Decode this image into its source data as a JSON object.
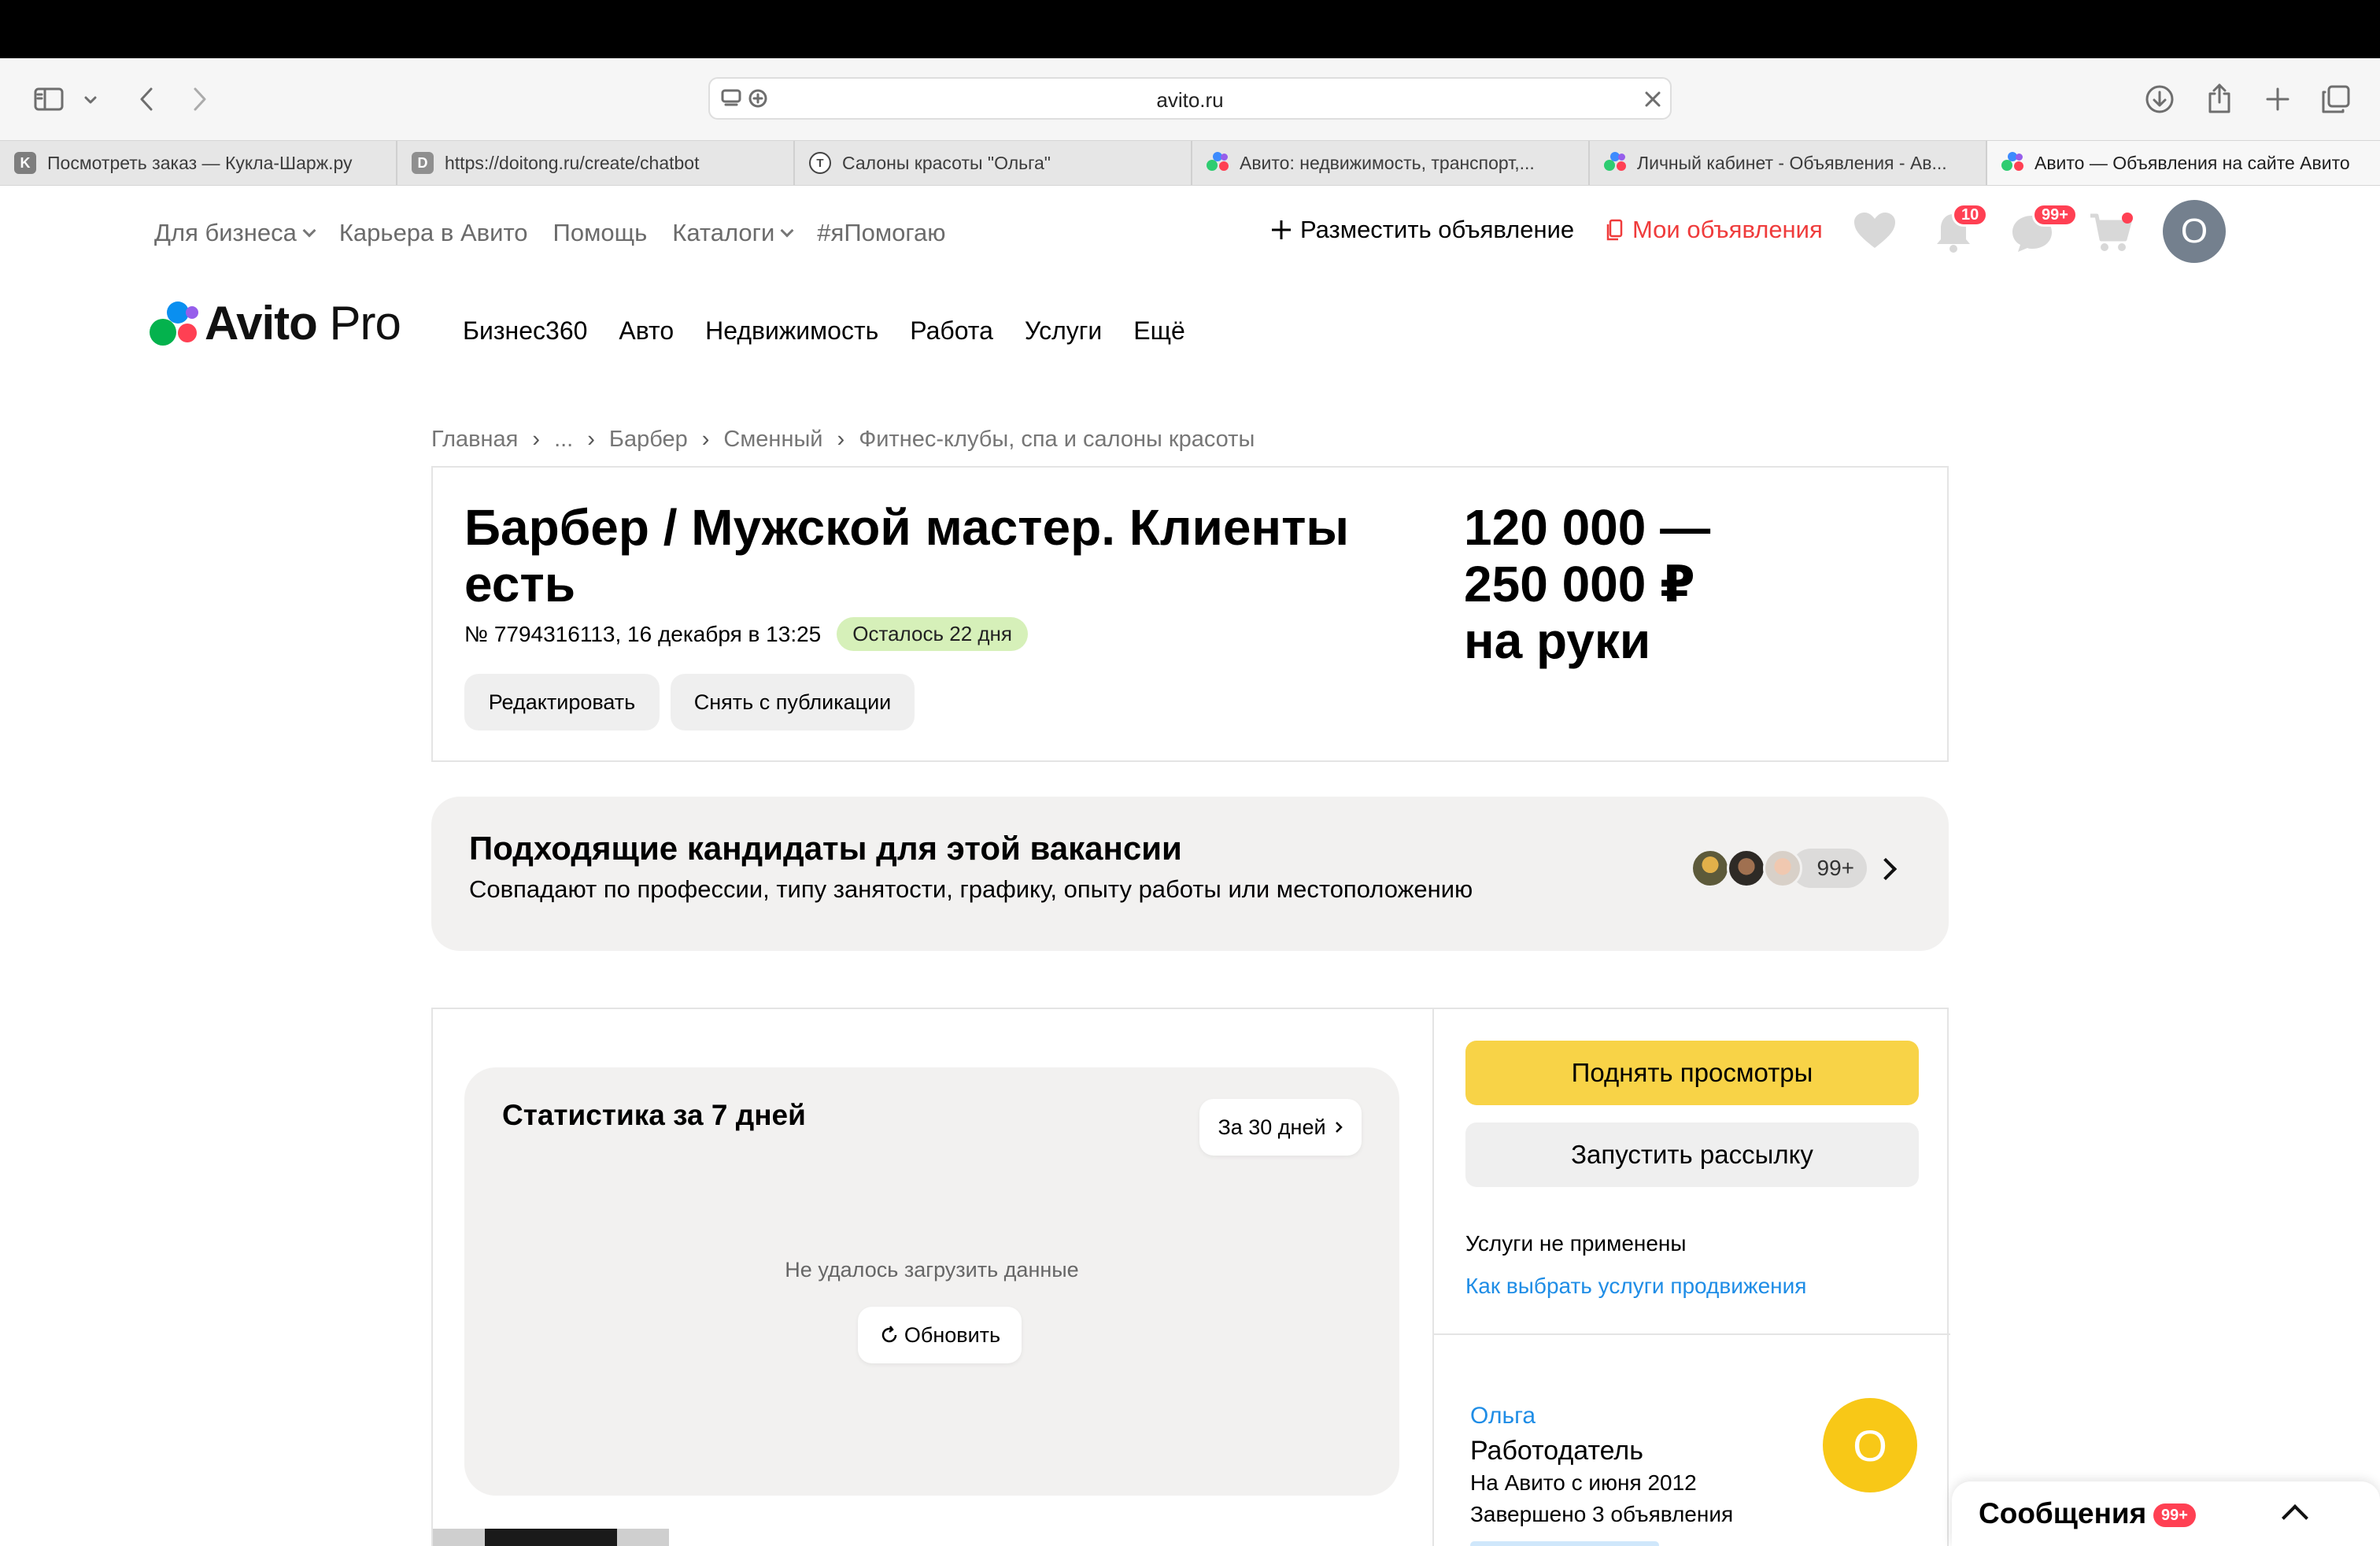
{
  "browser": {
    "url": "avito.ru",
    "tabs": [
      {
        "label": "Посмотреть заказ — Кукла-Шарж.ру",
        "favicon": "K"
      },
      {
        "label": "https://doitong.ru/create/chatbot",
        "favicon": "D"
      },
      {
        "label": "Салоны красоты \"Ольга\"",
        "favicon": "T"
      },
      {
        "label": "Авито: недвижимость, транспорт,...",
        "favicon": "avito"
      },
      {
        "label": "Личный кабинет - Объявления - Ав...",
        "favicon": "avito"
      },
      {
        "label": "Авито — Объявления на сайте Авито",
        "favicon": "avito"
      }
    ]
  },
  "header": {
    "top_links": [
      "Для бизнеса",
      "Карьера в Авито",
      "Помощь",
      "Каталоги",
      "#яПомогаю"
    ],
    "post_ad": "Разместить объявление",
    "my_ads": "Мои объявления",
    "notifications_badge": "10",
    "messages_badge": "99+",
    "avatar_letter": "O",
    "logo_bold": "Avito",
    "logo_light": "Pro",
    "nav": [
      "Бизнес360",
      "Авто",
      "Недвижимость",
      "Работа",
      "Услуги",
      "Ещё"
    ]
  },
  "breadcrumbs": [
    "Главная",
    "...",
    "Барбер",
    "Сменный",
    "Фитнес-клубы, спа и салоны красоты"
  ],
  "listing": {
    "title": "Барбер / Мужской мастер. Клиенты есть",
    "meta": "№ 7794316113, 16 декабря в 13:25",
    "days_left": "Осталось 22 дня",
    "edit_button": "Редактировать",
    "unpublish_button": "Снять с публикации",
    "price_line1": "120 000 —",
    "price_line2": "250 000 ₽",
    "price_line3": "на руки"
  },
  "candidates": {
    "title": "Подходящие кандидаты для этой вакансии",
    "subtitle": "Совпадают по профессии, типу занятости, графику, опыту работы или местоположению",
    "count": "99+"
  },
  "stats": {
    "title": "Статистика за 7 дней",
    "period_button": "За 30 дней",
    "error": "Не удалось загрузить данные",
    "refresh_button": "Обновить"
  },
  "sidebar": {
    "boost_button": "Поднять просмотры",
    "mailing_button": "Запустить рассылку",
    "services_status": "Услуги не применены",
    "services_link": "Как выбрать услуги продвижения",
    "seller_name": "Ольга",
    "seller_role": "Работодатель",
    "seller_since": "На Авито с июня 2012",
    "seller_completed": "Завершено 3 объявления",
    "seller_avatar_letter": "О"
  },
  "messages_dock": {
    "title": "Сообщения",
    "badge": "99+"
  },
  "colors": {
    "accent_red": "#ef3b3b",
    "link_blue": "#1f8de6",
    "yellow_button": "#f8d347",
    "green_pill": "#d6f0b9"
  }
}
